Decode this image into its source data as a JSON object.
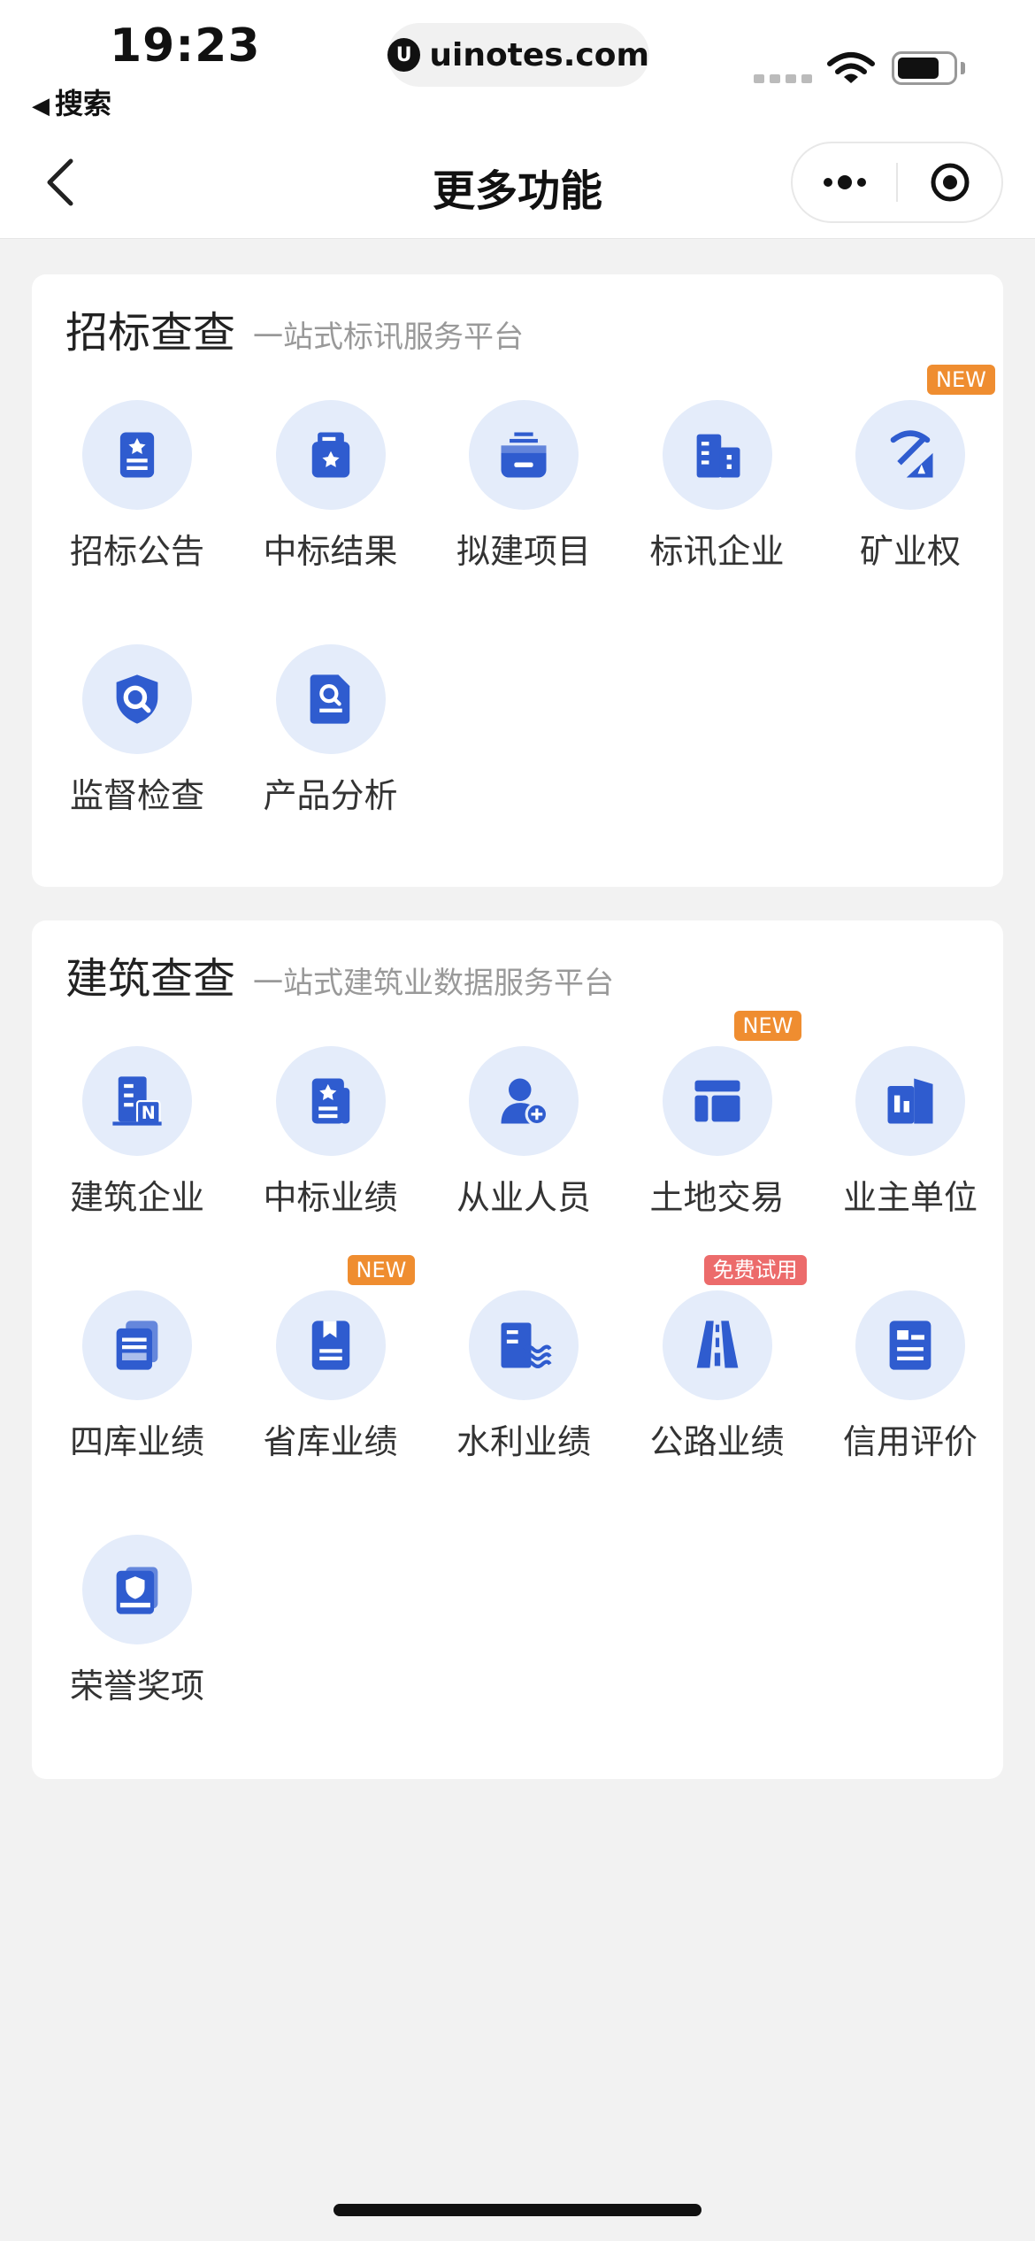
{
  "status_bar": {
    "time": "19:23",
    "back_app": "搜索",
    "url": "uinotes.com"
  },
  "nav": {
    "title": "更多功能",
    "more_icon": "more-dots-icon",
    "close_icon": "target-icon"
  },
  "bidding": {
    "title": "招标查查",
    "subtitle": "一站式标讯服务平台",
    "items": [
      {
        "label": "招标公告",
        "icon": "announcement-doc-icon"
      },
      {
        "label": "中标结果",
        "icon": "award-result-icon"
      },
      {
        "label": "拟建项目",
        "icon": "project-box-icon"
      },
      {
        "label": "标讯企业",
        "icon": "company-building-icon"
      },
      {
        "label": "矿业权",
        "icon": "mining-pickaxe-icon",
        "badge": "NEW"
      },
      {
        "label": "监督检查",
        "icon": "shield-search-icon"
      },
      {
        "label": "产品分析",
        "icon": "doc-search-icon"
      }
    ]
  },
  "construction": {
    "title": "建筑查查",
    "subtitle": "一站式建筑业数据服务平台",
    "items": [
      {
        "label": "建筑企业",
        "icon": "building-n-icon"
      },
      {
        "label": "中标业绩",
        "icon": "award-doc-icon"
      },
      {
        "label": "从业人员",
        "icon": "person-add-icon"
      },
      {
        "label": "土地交易",
        "icon": "land-layout-icon",
        "badge": "NEW"
      },
      {
        "label": "业主单位",
        "icon": "owner-building-icon"
      },
      {
        "label": "四库业绩",
        "icon": "stacked-docs-icon"
      },
      {
        "label": "省库业绩",
        "icon": "bookmark-doc-icon",
        "badge": "NEW"
      },
      {
        "label": "水利业绩",
        "icon": "water-building-icon"
      },
      {
        "label": "公路业绩",
        "icon": "road-icon",
        "badge": "免费试用"
      },
      {
        "label": "信用评价",
        "icon": "credit-card-doc-icon"
      },
      {
        "label": "荣誉奖项",
        "icon": "honor-shield-doc-icon"
      }
    ]
  },
  "colors": {
    "icon_blue": "#2f5ccf",
    "icon_bg": "#e4ecfa",
    "badge_new": "#ef8d30",
    "badge_trial": "#ec6b6b"
  }
}
